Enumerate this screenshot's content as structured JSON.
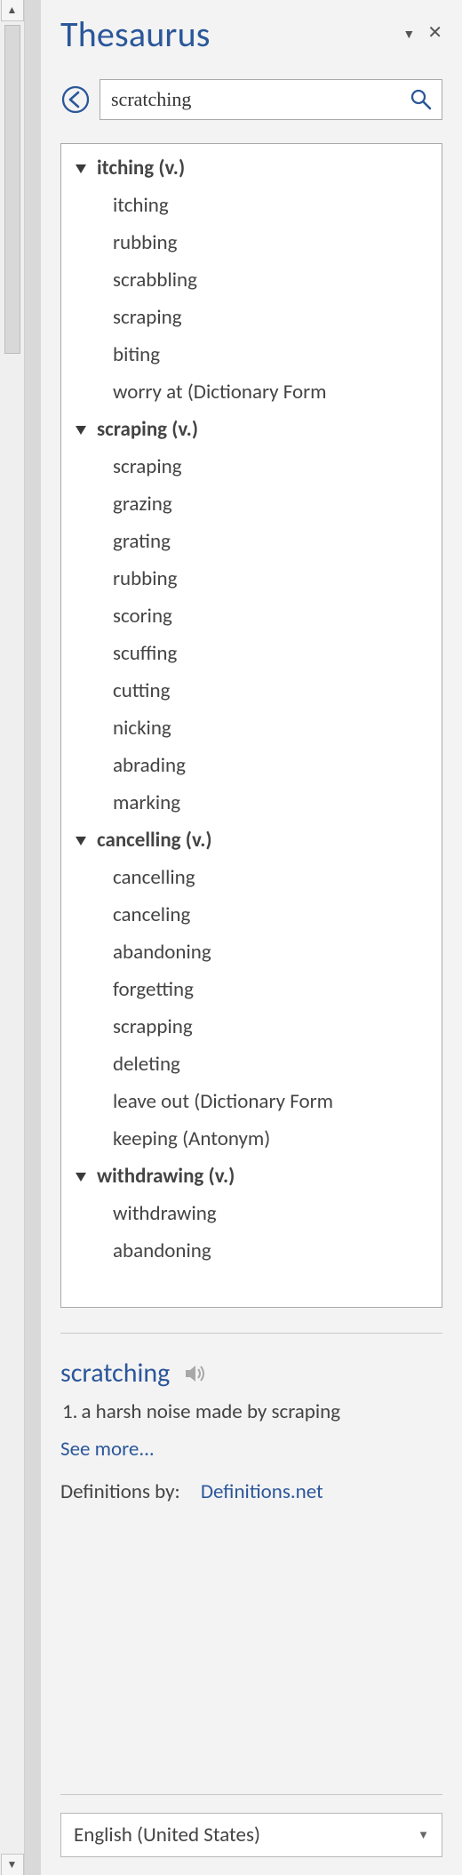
{
  "pane": {
    "title": "Thesaurus",
    "search_value": "scratching"
  },
  "results": {
    "groups": [
      {
        "header": "itching (v.)",
        "items": [
          "itching",
          "rubbing",
          "scrabbling",
          "scraping",
          "biting",
          "worry at (Dictionary Form"
        ]
      },
      {
        "header": "scraping (v.)",
        "items": [
          "scraping",
          "grazing",
          "grating",
          "rubbing",
          "scoring",
          "scuffing",
          "cutting",
          "nicking",
          "abrading",
          "marking"
        ]
      },
      {
        "header": "cancelling (v.)",
        "items": [
          "cancelling",
          "canceling",
          "abandoning",
          "forgetting",
          "scrapping",
          "deleting",
          "leave out (Dictionary Form",
          "keeping (Antonym)"
        ]
      },
      {
        "header": "withdrawing (v.)",
        "items": [
          "withdrawing",
          "abandoning"
        ]
      }
    ]
  },
  "definition": {
    "word": "scratching",
    "entries": [
      {
        "num": "1.",
        "text": "a harsh noise made by scraping"
      }
    ],
    "see_more": "See more...",
    "credit_label": "Definitions by:",
    "credit_link": "Definitions.net"
  },
  "language": {
    "selected": "English (United States)"
  }
}
